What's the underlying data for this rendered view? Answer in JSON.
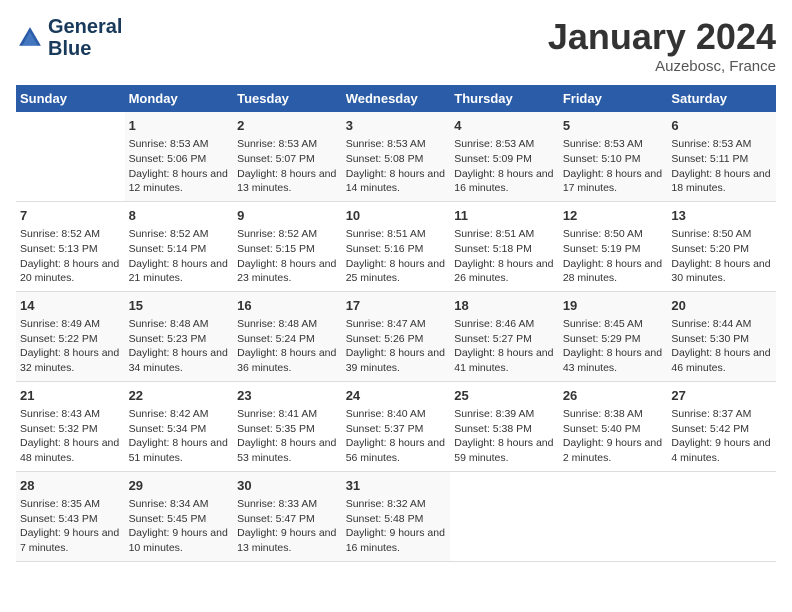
{
  "logo": {
    "line1": "General",
    "line2": "Blue"
  },
  "title": "January 2024",
  "location": "Auzebosc, France",
  "days_of_week": [
    "Sunday",
    "Monday",
    "Tuesday",
    "Wednesday",
    "Thursday",
    "Friday",
    "Saturday"
  ],
  "weeks": [
    [
      {
        "day": "",
        "sunrise": "",
        "sunset": "",
        "daylight": ""
      },
      {
        "day": "1",
        "sunrise": "8:53 AM",
        "sunset": "5:06 PM",
        "daylight": "8 hours and 12 minutes."
      },
      {
        "day": "2",
        "sunrise": "8:53 AM",
        "sunset": "5:07 PM",
        "daylight": "8 hours and 13 minutes."
      },
      {
        "day": "3",
        "sunrise": "8:53 AM",
        "sunset": "5:08 PM",
        "daylight": "8 hours and 14 minutes."
      },
      {
        "day": "4",
        "sunrise": "8:53 AM",
        "sunset": "5:09 PM",
        "daylight": "8 hours and 16 minutes."
      },
      {
        "day": "5",
        "sunrise": "8:53 AM",
        "sunset": "5:10 PM",
        "daylight": "8 hours and 17 minutes."
      },
      {
        "day": "6",
        "sunrise": "8:53 AM",
        "sunset": "5:11 PM",
        "daylight": "8 hours and 18 minutes."
      }
    ],
    [
      {
        "day": "7",
        "sunrise": "8:52 AM",
        "sunset": "5:13 PM",
        "daylight": "8 hours and 20 minutes."
      },
      {
        "day": "8",
        "sunrise": "8:52 AM",
        "sunset": "5:14 PM",
        "daylight": "8 hours and 21 minutes."
      },
      {
        "day": "9",
        "sunrise": "8:52 AM",
        "sunset": "5:15 PM",
        "daylight": "8 hours and 23 minutes."
      },
      {
        "day": "10",
        "sunrise": "8:51 AM",
        "sunset": "5:16 PM",
        "daylight": "8 hours and 25 minutes."
      },
      {
        "day": "11",
        "sunrise": "8:51 AM",
        "sunset": "5:18 PM",
        "daylight": "8 hours and 26 minutes."
      },
      {
        "day": "12",
        "sunrise": "8:50 AM",
        "sunset": "5:19 PM",
        "daylight": "8 hours and 28 minutes."
      },
      {
        "day": "13",
        "sunrise": "8:50 AM",
        "sunset": "5:20 PM",
        "daylight": "8 hours and 30 minutes."
      }
    ],
    [
      {
        "day": "14",
        "sunrise": "8:49 AM",
        "sunset": "5:22 PM",
        "daylight": "8 hours and 32 minutes."
      },
      {
        "day": "15",
        "sunrise": "8:48 AM",
        "sunset": "5:23 PM",
        "daylight": "8 hours and 34 minutes."
      },
      {
        "day": "16",
        "sunrise": "8:48 AM",
        "sunset": "5:24 PM",
        "daylight": "8 hours and 36 minutes."
      },
      {
        "day": "17",
        "sunrise": "8:47 AM",
        "sunset": "5:26 PM",
        "daylight": "8 hours and 39 minutes."
      },
      {
        "day": "18",
        "sunrise": "8:46 AM",
        "sunset": "5:27 PM",
        "daylight": "8 hours and 41 minutes."
      },
      {
        "day": "19",
        "sunrise": "8:45 AM",
        "sunset": "5:29 PM",
        "daylight": "8 hours and 43 minutes."
      },
      {
        "day": "20",
        "sunrise": "8:44 AM",
        "sunset": "5:30 PM",
        "daylight": "8 hours and 46 minutes."
      }
    ],
    [
      {
        "day": "21",
        "sunrise": "8:43 AM",
        "sunset": "5:32 PM",
        "daylight": "8 hours and 48 minutes."
      },
      {
        "day": "22",
        "sunrise": "8:42 AM",
        "sunset": "5:34 PM",
        "daylight": "8 hours and 51 minutes."
      },
      {
        "day": "23",
        "sunrise": "8:41 AM",
        "sunset": "5:35 PM",
        "daylight": "8 hours and 53 minutes."
      },
      {
        "day": "24",
        "sunrise": "8:40 AM",
        "sunset": "5:37 PM",
        "daylight": "8 hours and 56 minutes."
      },
      {
        "day": "25",
        "sunrise": "8:39 AM",
        "sunset": "5:38 PM",
        "daylight": "8 hours and 59 minutes."
      },
      {
        "day": "26",
        "sunrise": "8:38 AM",
        "sunset": "5:40 PM",
        "daylight": "9 hours and 2 minutes."
      },
      {
        "day": "27",
        "sunrise": "8:37 AM",
        "sunset": "5:42 PM",
        "daylight": "9 hours and 4 minutes."
      }
    ],
    [
      {
        "day": "28",
        "sunrise": "8:35 AM",
        "sunset": "5:43 PM",
        "daylight": "9 hours and 7 minutes."
      },
      {
        "day": "29",
        "sunrise": "8:34 AM",
        "sunset": "5:45 PM",
        "daylight": "9 hours and 10 minutes."
      },
      {
        "day": "30",
        "sunrise": "8:33 AM",
        "sunset": "5:47 PM",
        "daylight": "9 hours and 13 minutes."
      },
      {
        "day": "31",
        "sunrise": "8:32 AM",
        "sunset": "5:48 PM",
        "daylight": "9 hours and 16 minutes."
      },
      {
        "day": "",
        "sunrise": "",
        "sunset": "",
        "daylight": ""
      },
      {
        "day": "",
        "sunrise": "",
        "sunset": "",
        "daylight": ""
      },
      {
        "day": "",
        "sunrise": "",
        "sunset": "",
        "daylight": ""
      }
    ]
  ],
  "labels": {
    "sunrise_prefix": "Sunrise: ",
    "sunset_prefix": "Sunset: ",
    "daylight_prefix": "Daylight: "
  }
}
